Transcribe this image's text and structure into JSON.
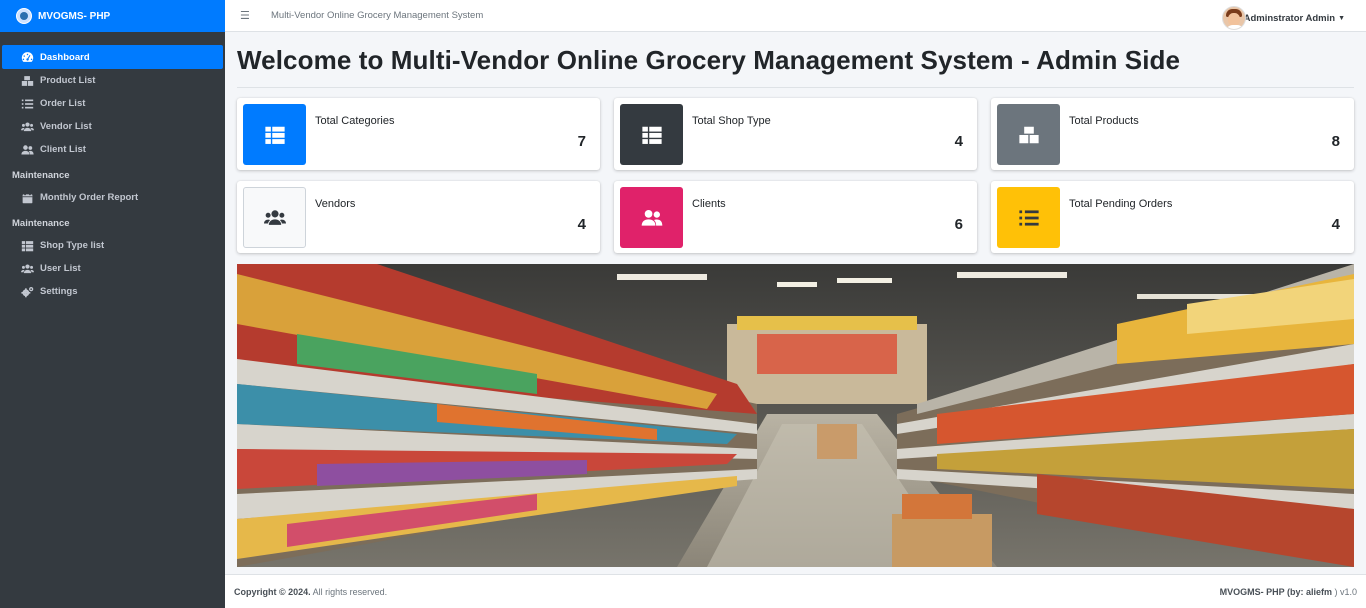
{
  "brand": {
    "name": "MVOGMS- PHP"
  },
  "topbar": {
    "title": "Multi-Vendor Online Grocery Management System",
    "user": "Adminstrator Admin"
  },
  "sidebar": {
    "items": [
      {
        "label": "Dashboard",
        "icon": "dashboard-icon",
        "active": true
      },
      {
        "label": "Product List",
        "icon": "boxes-icon"
      },
      {
        "label": "Order List",
        "icon": "list-icon"
      },
      {
        "label": "Vendor List",
        "icon": "users-icon"
      },
      {
        "label": "Client List",
        "icon": "user-friends-icon"
      }
    ],
    "section1": "Maintenance",
    "items2": [
      {
        "label": "Monthly Order Report",
        "icon": "calendar-icon"
      }
    ],
    "section2": "Maintenance",
    "items3": [
      {
        "label": "Shop Type list",
        "icon": "table-icon"
      },
      {
        "label": "User List",
        "icon": "users-icon"
      },
      {
        "label": "Settings",
        "icon": "cogs-icon"
      }
    ]
  },
  "main": {
    "title": "Welcome to Multi-Vendor Online Grocery Management System - Admin Side",
    "cards": [
      {
        "label": "Total Categories",
        "value": "7",
        "color": "#007bff",
        "icon": "table-icon"
      },
      {
        "label": "Total Shop Type",
        "value": "4",
        "color": "#343a40",
        "icon": "table-icon"
      },
      {
        "label": "Total Products",
        "value": "8",
        "color": "#6c757d",
        "icon": "boxes-icon"
      },
      {
        "label": "Vendors",
        "value": "4",
        "color": "#f8f9fa",
        "icon": "users-icon"
      },
      {
        "label": "Clients",
        "value": "6",
        "color": "#e83e8c",
        "icon": "user-friends-icon"
      },
      {
        "label": "Total Pending Orders",
        "value": "4",
        "color": "#ffc107",
        "icon": "list-icon"
      }
    ]
  },
  "footer": {
    "left_prefix": "Copyright © 2024.",
    "left_suffix": " All rights reserved.",
    "right_prefix": "MVOGMS- PHP (by: ",
    "right_author": "aliefm",
    "right_suffix": " ) v1.0"
  }
}
